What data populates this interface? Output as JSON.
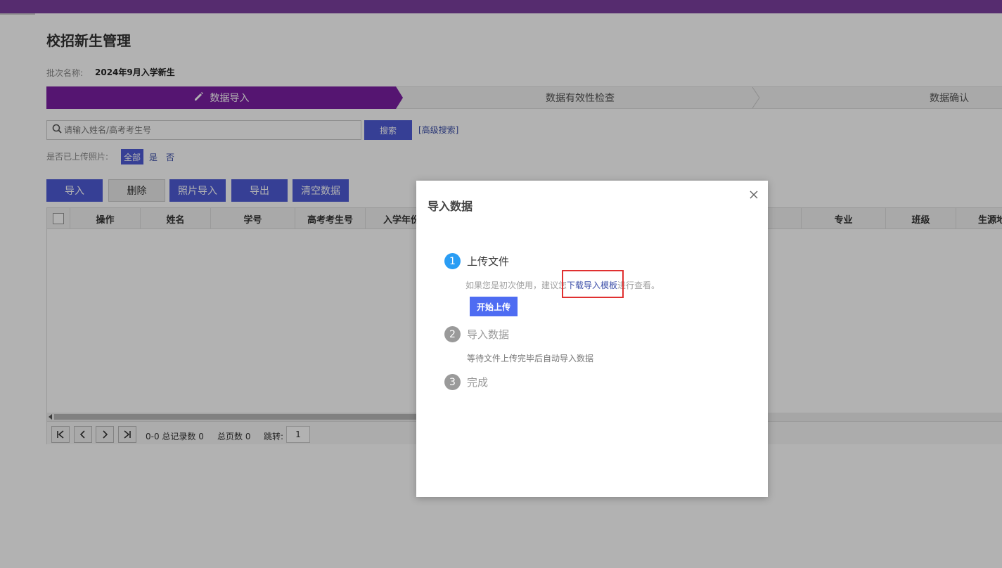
{
  "page": {
    "title": "校招新生管理",
    "batch_label": "批次名称:",
    "batch_value": "2024年9月入学新生"
  },
  "steps": [
    {
      "label": "数据导入",
      "active": true
    },
    {
      "label": "数据有效性检查",
      "active": false
    },
    {
      "label": "数据确认",
      "active": false
    }
  ],
  "search": {
    "placeholder": "请输入姓名/高考考生号",
    "button": "搜索",
    "advanced": "[高级搜索]"
  },
  "filter": {
    "label": "是否已上传照片:",
    "all": "全部",
    "yes": "是",
    "no": "否"
  },
  "toolbar": {
    "import": "导入",
    "delete": "删除",
    "photo_import": "照片导入",
    "export": "导出",
    "clear": "清空数据"
  },
  "table": {
    "columns": [
      "操作",
      "姓名",
      "学号",
      "高考考生号",
      "入学年份",
      "专业",
      "班级",
      "生源地"
    ]
  },
  "pager": {
    "range": "0-0 总记录数 0",
    "pages": "总页数 0",
    "jump_label": "跳转:",
    "jump_value": "1"
  },
  "modal": {
    "title": "导入数据",
    "step1": {
      "num": "1",
      "title": "上传文件"
    },
    "hint_prefix": "如果您是初次使用，建议您",
    "hint_link": "下载导入模板",
    "hint_suffix": "进行查看。",
    "upload_button": "开始上传",
    "step2": {
      "num": "2",
      "title": "导入数据",
      "desc": "等待文件上传完毕后自动导入数据"
    },
    "step3": {
      "num": "3",
      "title": "完成"
    }
  },
  "colors": {
    "topbar": "#7b3fa0",
    "step_active": "#7a1fa2",
    "button": "#4e5bd6",
    "step_circle_active": "#2a9df4",
    "highlight_box": "#e03030"
  }
}
